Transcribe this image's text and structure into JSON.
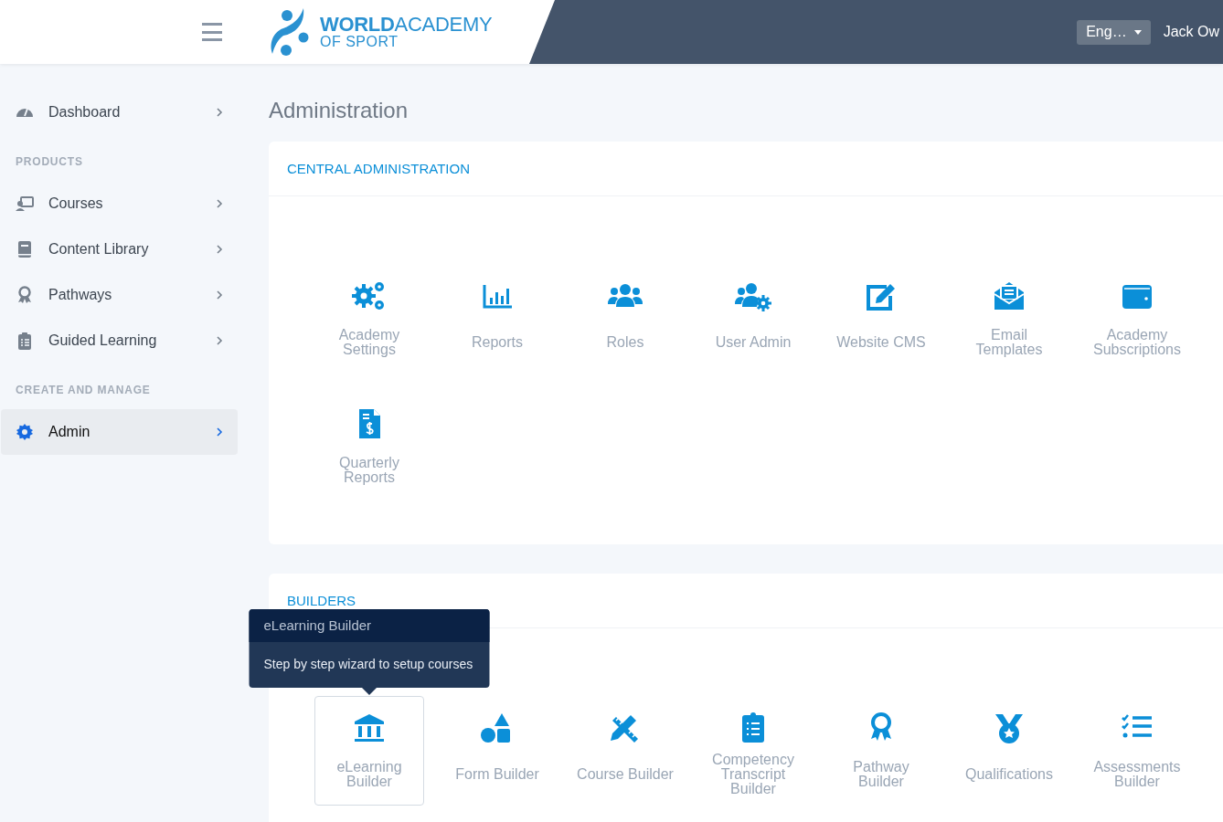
{
  "header": {
    "logo_main": "**WORLD**ACADEMY",
    "logo_sub": "OF SPORT",
    "language": "Eng…",
    "user": "Jack Ow"
  },
  "sidebar": {
    "groups": [
      {
        "items": [
          {
            "label": "Dashboard",
            "selected": false
          }
        ]
      },
      {
        "heading": "PRODUCTS",
        "items": [
          {
            "label": "Courses",
            "selected": false
          },
          {
            "label": "Content Library",
            "selected": false
          },
          {
            "label": "Pathways",
            "selected": false
          },
          {
            "label": "Guided Learning",
            "selected": false
          }
        ]
      },
      {
        "heading": "CREATE AND MANAGE",
        "items": [
          {
            "label": "Admin",
            "selected": true
          }
        ]
      }
    ]
  },
  "page_title": "Administration",
  "sections": [
    {
      "title": "CENTRAL ADMINISTRATION",
      "tiles": [
        {
          "label": "Academy Settings",
          "highlighted": false
        },
        {
          "label": "Reports",
          "highlighted": false
        },
        {
          "label": "Roles",
          "highlighted": false
        },
        {
          "label": "User Admin",
          "highlighted": false
        },
        {
          "label": "Website CMS",
          "highlighted": false
        },
        {
          "label": "Email Templates",
          "highlighted": false
        },
        {
          "label": "Academy Subscriptions",
          "highlighted": false
        },
        {
          "label": "Quarterly Reports",
          "highlighted": false
        }
      ]
    },
    {
      "title": "BUILDERS",
      "tooltip": {
        "title": "eLearning Builder",
        "text": "Step by step wizard to setup courses"
      },
      "tiles": [
        {
          "label": "eLearning Builder",
          "highlighted": true
        },
        {
          "label": "Form Builder",
          "highlighted": false
        },
        {
          "label": "Course Builder",
          "highlighted": false
        },
        {
          "label": "Competency Transcript Builder",
          "highlighted": false
        },
        {
          "label": "Pathway Builder",
          "highlighted": false
        },
        {
          "label": "Qualifications",
          "highlighted": false
        },
        {
          "label": "Assessments Builder",
          "highlighted": false
        }
      ]
    }
  ]
}
